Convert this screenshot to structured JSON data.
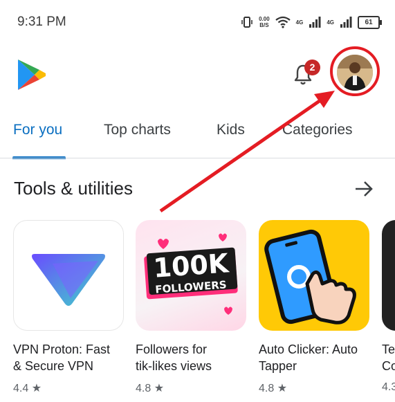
{
  "status_bar": {
    "time": "9:31 PM",
    "net_speed_value": "0.00",
    "net_speed_unit": "B/S",
    "signal1": "4G",
    "signal2": "4G",
    "battery": "61"
  },
  "header": {
    "notification_count": "2"
  },
  "tabs": [
    {
      "label": "For you"
    },
    {
      "label": "Top charts"
    },
    {
      "label": "Kids"
    },
    {
      "label": "Categories"
    }
  ],
  "section": {
    "title": "Tools & utilities"
  },
  "apps": [
    {
      "name": "VPN Proton: Fast\n& Secure VPN",
      "rating": "4.4 ★"
    },
    {
      "name": "Followers for\ntik-likes  views",
      "rating": "4.8 ★",
      "icon_text_top": "100K",
      "icon_text_bottom": "FOLLOWERS"
    },
    {
      "name": "Auto Clicker: Auto\nTapper",
      "rating": "4.8 ★"
    },
    {
      "name": "Te\nCo",
      "rating": "4.3"
    }
  ],
  "colors": {
    "accent": "#0b6fc1",
    "annotation_red": "#e41c23",
    "badge": "#c62828"
  }
}
